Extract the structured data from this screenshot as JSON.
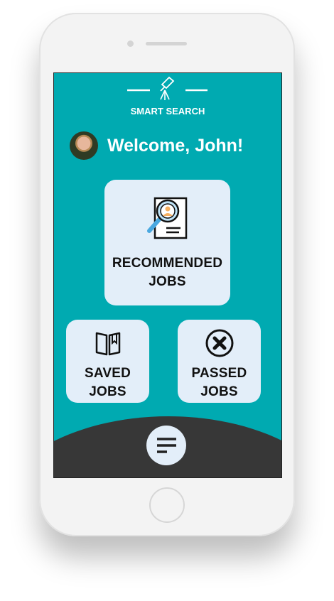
{
  "app": {
    "brand": "SMART SEARCH",
    "logo_icon": "telescope-icon"
  },
  "header": {
    "welcome": "Welcome, John!"
  },
  "cards": {
    "recommended": {
      "line1": "RECOMMENDED",
      "line2": "JOBS",
      "icon": "resume-search-icon"
    },
    "saved": {
      "line1": "SAVED",
      "line2": "JOBS",
      "icon": "bookmark-book-icon"
    },
    "passed": {
      "line1": "PASSED",
      "line2": "JOBS",
      "icon": "x-circle-icon"
    }
  },
  "nav": {
    "menu_icon": "menu-lines-icon"
  },
  "colors": {
    "primary": "#00aab1",
    "card": "#e3eef9",
    "bottom_bar": "#373737"
  }
}
